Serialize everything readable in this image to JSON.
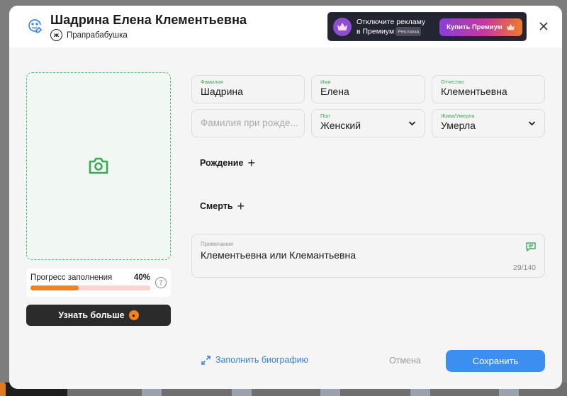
{
  "header": {
    "name": "Шадрина Елена Клементьевна",
    "relation_badge": "ж",
    "relation": "Прапрабабушка",
    "close_label": "×"
  },
  "promo": {
    "line1": "Отключите рекламу",
    "line2": "в Премиум",
    "ad_tag": "Реклама",
    "button_label": "Купить Премиум"
  },
  "photo": {
    "icon": "camera-icon"
  },
  "progress": {
    "label": "Прогресс заполнения",
    "percent_text": "40%",
    "percent_value": 40,
    "help": "?"
  },
  "learn_more": {
    "label": "Узнать больше"
  },
  "form": {
    "surname": {
      "label": "Фамилия",
      "value": "Шадрина"
    },
    "first_name": {
      "label": "Имя",
      "value": "Елена"
    },
    "patronymic": {
      "label": "Отчество",
      "value": "Клементьевна"
    },
    "maiden_name": {
      "placeholder": "Фамилия при рожде..."
    },
    "gender": {
      "label": "Пол",
      "value": "Женский"
    },
    "status": {
      "label": "Жива/Умерла",
      "value": "Умерла"
    }
  },
  "sections": {
    "birth": "Рождение",
    "death": "Смерть",
    "plus": "+"
  },
  "note": {
    "label": "Примечание",
    "value": "Клементьевна или Клемантьевна",
    "counter": "29/140"
  },
  "actions": {
    "fill_bio": "Заполнить биографию",
    "cancel": "Отмена",
    "save": "Сохранить"
  },
  "colors": {
    "accent_green": "#3aab55",
    "accent_blue": "#3b8ff0",
    "progress_orange": "#f5821f",
    "dark_button": "#2b2b2b"
  }
}
